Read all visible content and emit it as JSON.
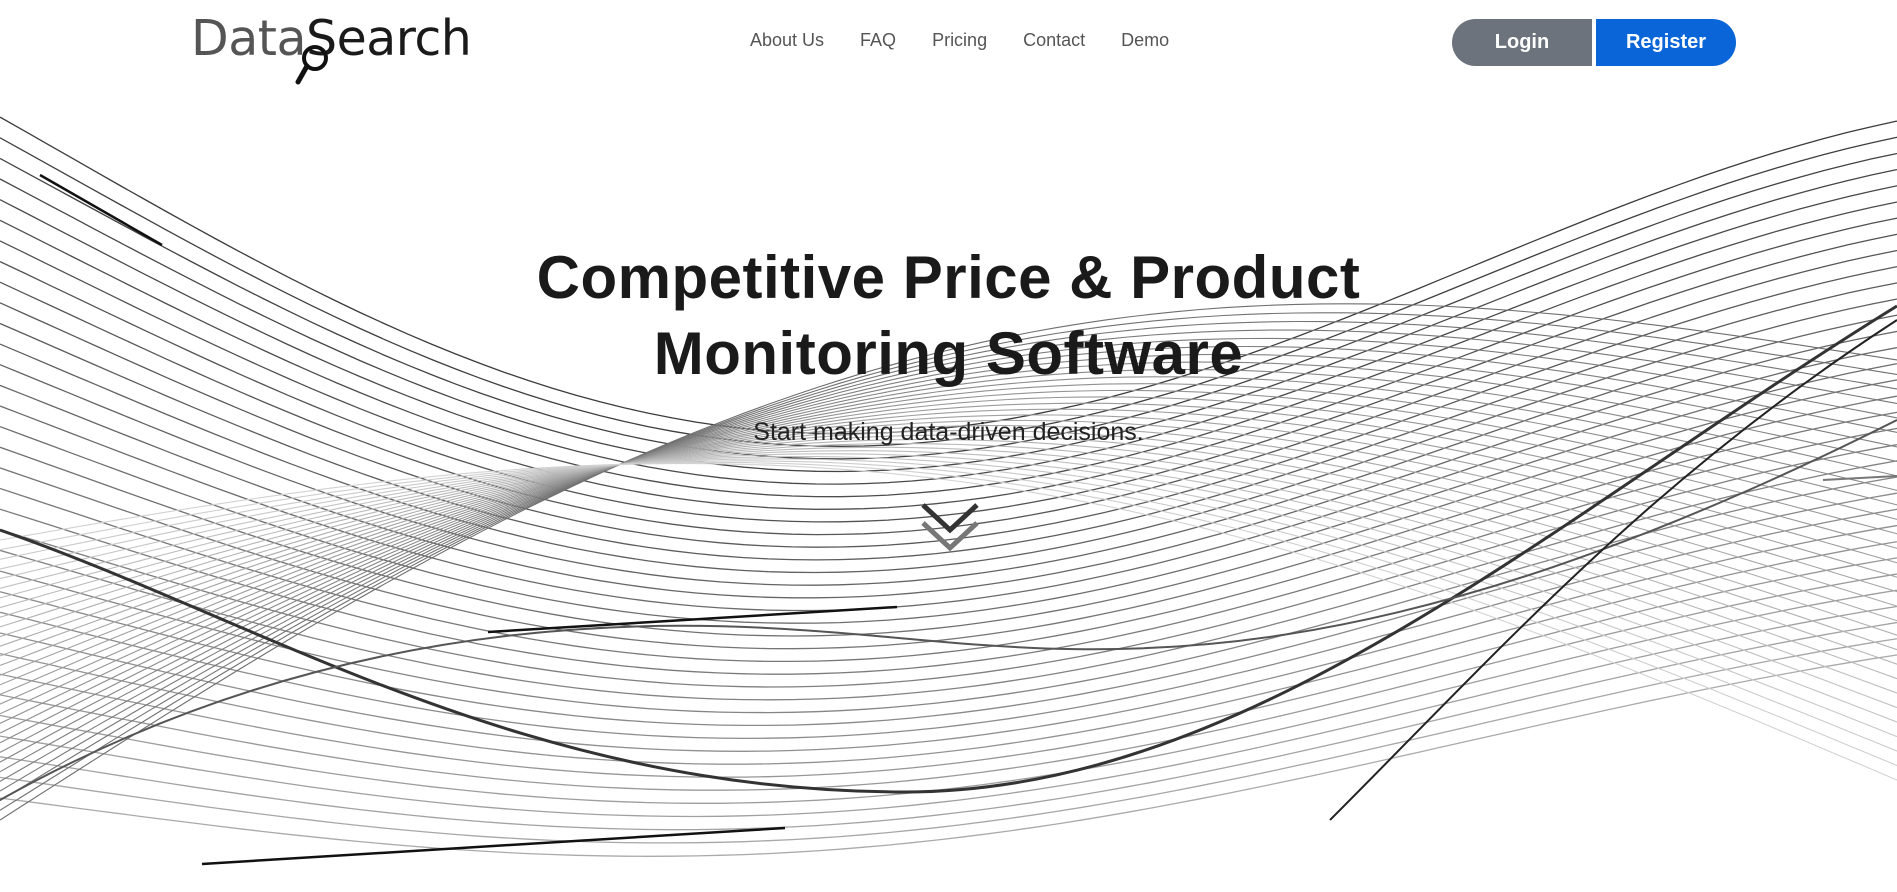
{
  "brand": {
    "logo_first": "Data",
    "logo_second": "Search",
    "accent_color": "#0a66d8",
    "secondary_color": "#6c737c"
  },
  "nav": {
    "items": [
      {
        "label": "About Us"
      },
      {
        "label": "FAQ"
      },
      {
        "label": "Pricing"
      },
      {
        "label": "Contact"
      },
      {
        "label": "Demo"
      }
    ]
  },
  "auth": {
    "login_label": "Login",
    "register_label": "Register"
  },
  "hero": {
    "title_line1": "Competitive Price & Product",
    "title_line2": "Monitoring Software",
    "subtitle": "Start making data-driven decisions."
  },
  "icons": {
    "scroll": "double-chevron-down-icon",
    "logo": "magnifier-icon"
  }
}
